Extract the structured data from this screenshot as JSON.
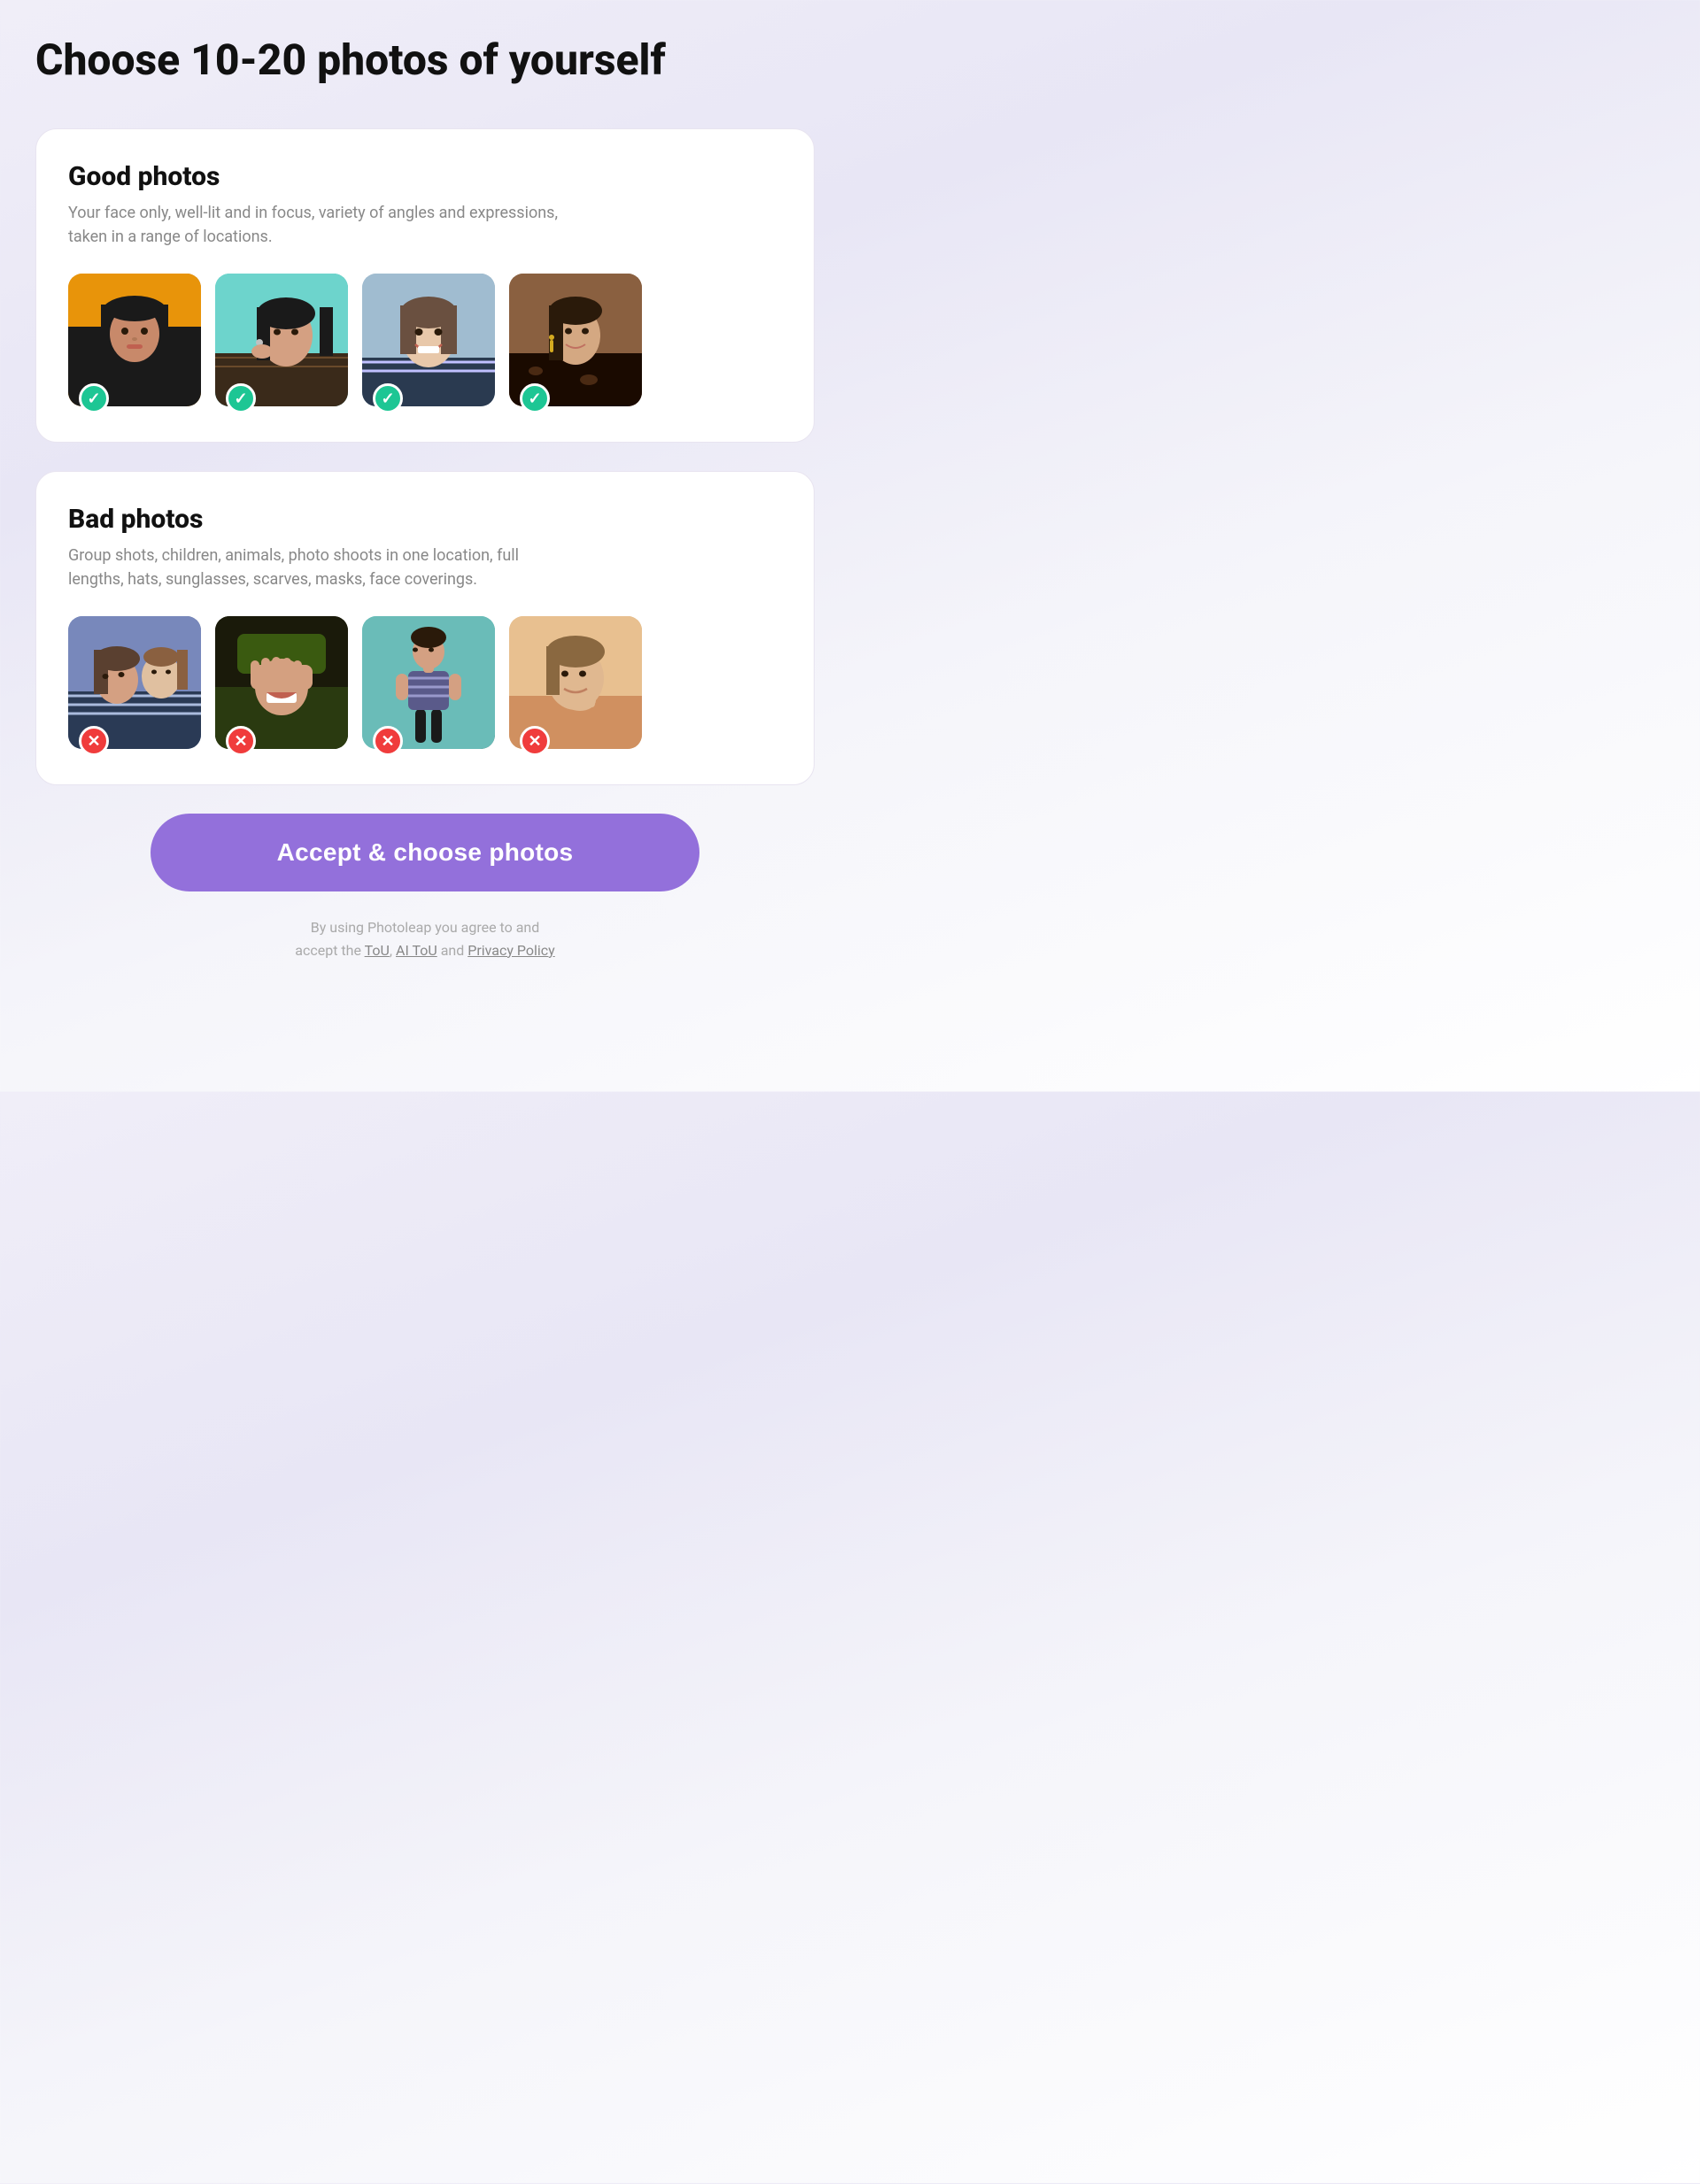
{
  "page": {
    "title": "Choose 10-20 photos of yourself",
    "background_gradient_start": "#f0eef8",
    "background_gradient_end": "#ffffff"
  },
  "good_photos_card": {
    "title": "Good photos",
    "description": "Your face only, well-lit and in focus, variety of angles and expressions, taken in a range of locations.",
    "photos": [
      {
        "id": "good-1",
        "bg_class": "good-photo-1"
      },
      {
        "id": "good-2",
        "bg_class": "good-photo-2"
      },
      {
        "id": "good-3",
        "bg_class": "good-photo-3"
      },
      {
        "id": "good-4",
        "bg_class": "good-photo-4"
      }
    ],
    "badge_type": "good"
  },
  "bad_photos_card": {
    "title": "Bad photos",
    "description": "Group shots, children, animals, photo shoots in one location, full lengths, hats, sunglasses, scarves, masks, face coverings.",
    "photos": [
      {
        "id": "bad-1",
        "bg_class": "bad-photo-1"
      },
      {
        "id": "bad-2",
        "bg_class": "bad-photo-2"
      },
      {
        "id": "bad-3",
        "bg_class": "bad-photo-3"
      },
      {
        "id": "bad-4",
        "bg_class": "bad-photo-4"
      }
    ],
    "badge_type": "bad"
  },
  "button": {
    "label": "Accept & choose photos",
    "bg_color": "#9370db"
  },
  "footer": {
    "text_before": "By using Photoleap you agree to and\naccept the ",
    "link1": "ToU",
    "separator": ", ",
    "link2": "AI ToU",
    "text_between": " and ",
    "link3": "Privacy Policy"
  },
  "icons": {
    "checkmark": "✓",
    "cross": "✕"
  }
}
